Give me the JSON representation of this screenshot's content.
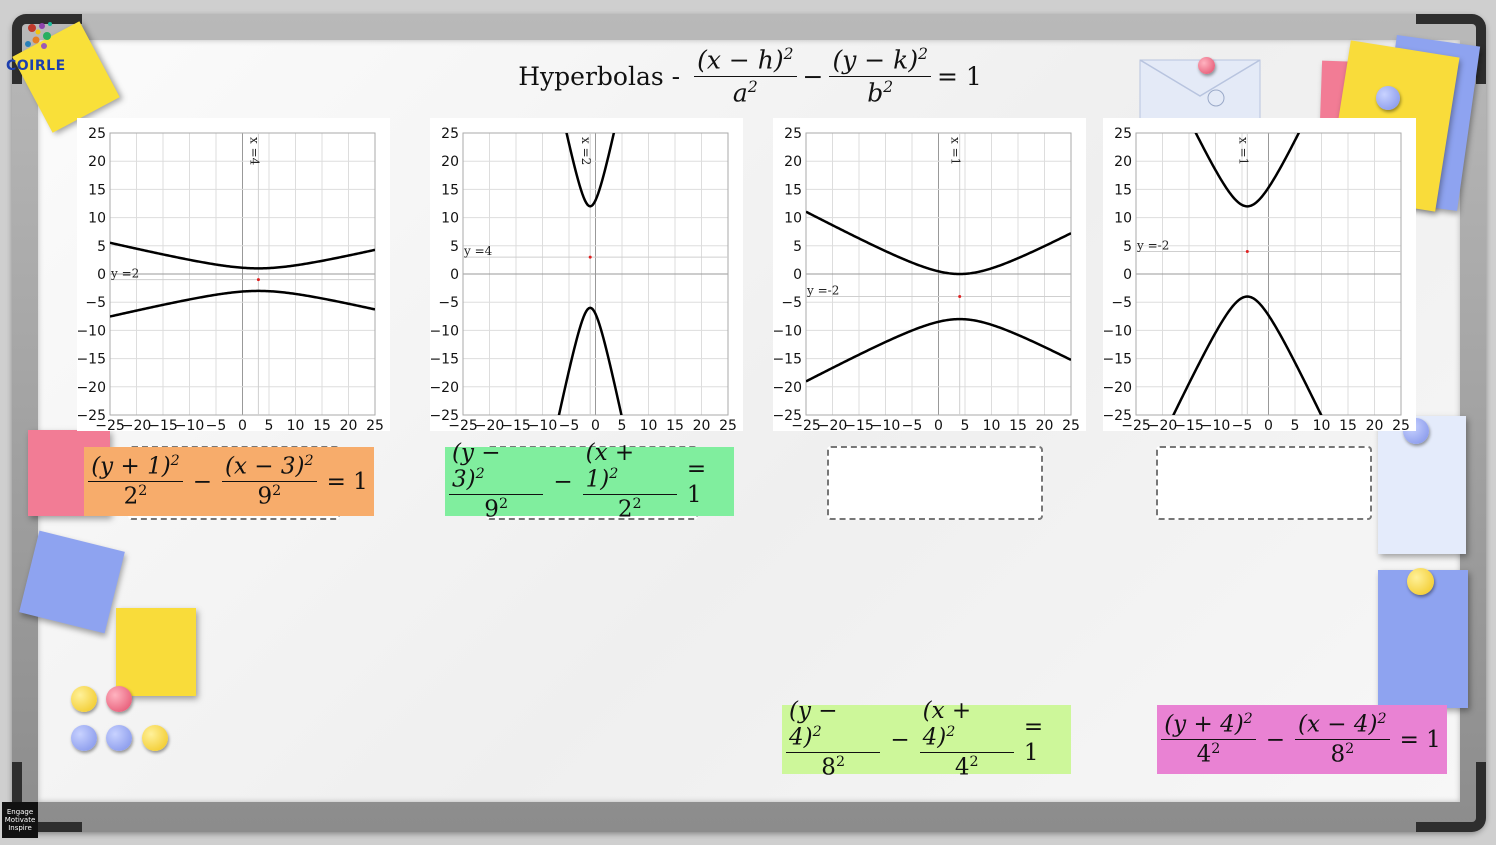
{
  "app": {
    "logo_text": "COIRLE",
    "badge_lines": [
      "Engage",
      "Motivate",
      "Inspire"
    ]
  },
  "title": {
    "prefix": "Hyperbolas -",
    "formula": {
      "num1": "(x − h)",
      "den1": "a",
      "op": "−",
      "num2": "(y − k)",
      "den2": "b",
      "equals": "= 1",
      "exp": "2"
    }
  },
  "colors": {
    "orange_card": "#f7ac6b",
    "green_card": "#80ee9e",
    "lime_card": "#cdf79a",
    "magenta_card": "#e982d3",
    "curve": "#000000",
    "center_dot": "#e02020"
  },
  "graphs": [
    {
      "xline_label": "x =4",
      "yline_label": "y =2"
    },
    {
      "xline_label": "x =2",
      "yline_label": "y =4"
    },
    {
      "xline_label": "x =1",
      "yline_label": "y =-2"
    },
    {
      "xline_label": "x =1",
      "yline_label": "y =-2"
    }
  ],
  "chart_data": [
    {
      "type": "line",
      "xlim": [
        -25,
        25
      ],
      "ylim": [
        -25,
        25
      ],
      "xticks": [
        -25,
        -20,
        -15,
        -10,
        -5,
        0,
        5,
        10,
        15,
        20,
        25
      ],
      "yticks": [
        -25,
        -20,
        -15,
        -10,
        -5,
        0,
        5,
        10,
        15,
        20,
        25
      ],
      "grid": true,
      "hyperbola": {
        "orientation": "vertical",
        "h": 3,
        "k": -1,
        "a": 2,
        "b": 9
      },
      "center": [
        3,
        -1
      ]
    },
    {
      "type": "line",
      "xlim": [
        -25,
        25
      ],
      "ylim": [
        -25,
        25
      ],
      "xticks": [
        -25,
        -20,
        -15,
        -10,
        -5,
        0,
        5,
        10,
        15,
        20,
        25
      ],
      "yticks": [
        -25,
        -20,
        -15,
        -10,
        -5,
        0,
        5,
        10,
        15,
        20,
        25
      ],
      "grid": true,
      "hyperbola": {
        "orientation": "vertical",
        "h": -1,
        "k": 3,
        "a": 9,
        "b": 2
      },
      "center": [
        -1,
        3
      ]
    },
    {
      "type": "line",
      "xlim": [
        -25,
        25
      ],
      "ylim": [
        -25,
        25
      ],
      "xticks": [
        -25,
        -20,
        -15,
        -10,
        -5,
        0,
        5,
        10,
        15,
        20,
        25
      ],
      "yticks": [
        -25,
        -20,
        -15,
        -10,
        -5,
        0,
        5,
        10,
        15,
        20,
        25
      ],
      "grid": true,
      "hyperbola": {
        "orientation": "vertical",
        "h": 4,
        "k": -4,
        "a": 4,
        "b": 8
      },
      "center": [
        4,
        -4
      ]
    },
    {
      "type": "line",
      "xlim": [
        -25,
        25
      ],
      "ylim": [
        -25,
        25
      ],
      "xticks": [
        -25,
        -20,
        -15,
        -10,
        -5,
        0,
        5,
        10,
        15,
        20,
        25
      ],
      "yticks": [
        -25,
        -20,
        -15,
        -10,
        -5,
        0,
        5,
        10,
        15,
        20,
        25
      ],
      "grid": true,
      "hyperbola": {
        "orientation": "vertical",
        "h": -4,
        "k": 4,
        "a": 8,
        "b": 4
      },
      "center": [
        -4,
        4
      ]
    }
  ],
  "cards": {
    "card1": {
      "n1": "(y + 1)",
      "d1": "2",
      "n2": "(x − 3)",
      "d2": "9",
      "op": "−",
      "eq": "= 1",
      "exp": "2"
    },
    "card2": {
      "n1": "(y − 3)",
      "d1": "9",
      "n2": "(x + 1)",
      "d2": "2",
      "op": "−",
      "eq": "= 1",
      "exp": "2"
    },
    "card3": {
      "n1": "(y − 4)",
      "d1": "8",
      "n2": "(x + 4)",
      "d2": "4",
      "op": "−",
      "eq": "= 1",
      "exp": "2"
    },
    "card4": {
      "n1": "(y + 4)",
      "d1": "4",
      "n2": "(x − 4)",
      "d2": "8",
      "op": "−",
      "eq": "= 1",
      "exp": "2"
    }
  }
}
